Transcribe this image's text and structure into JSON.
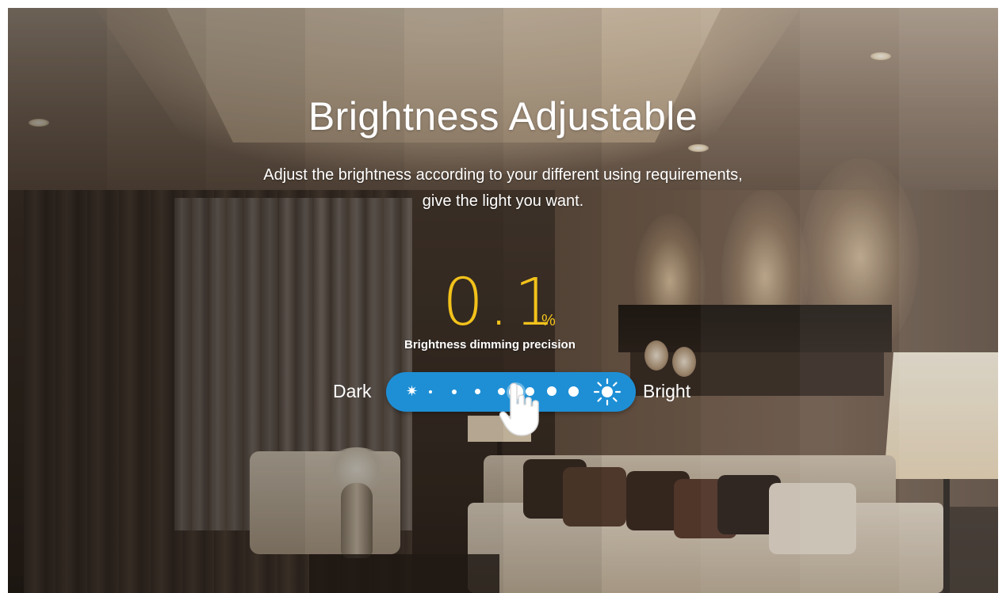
{
  "banner": {
    "title": "Brightness Adjustable",
    "subtitle_line1": "Adjust the brightness according to your different using requirements,",
    "subtitle_line2": "give the light you want.",
    "precision_value": "0.1",
    "precision_unit": "%",
    "precision_label": "Brightness dimming precision",
    "dark_label": "Dark",
    "bright_label": "Bright"
  },
  "slider": {
    "color": "#1e8fd5",
    "steps": 8,
    "current_step": 5,
    "icons": [
      "sun-small-icon",
      "dot",
      "dot",
      "dot",
      "dot",
      "dot",
      "dot",
      "dot",
      "sun-large-icon"
    ]
  },
  "colors": {
    "accent": "#f2c21b",
    "slider": "#1e8fd5",
    "text": "#ffffff"
  }
}
